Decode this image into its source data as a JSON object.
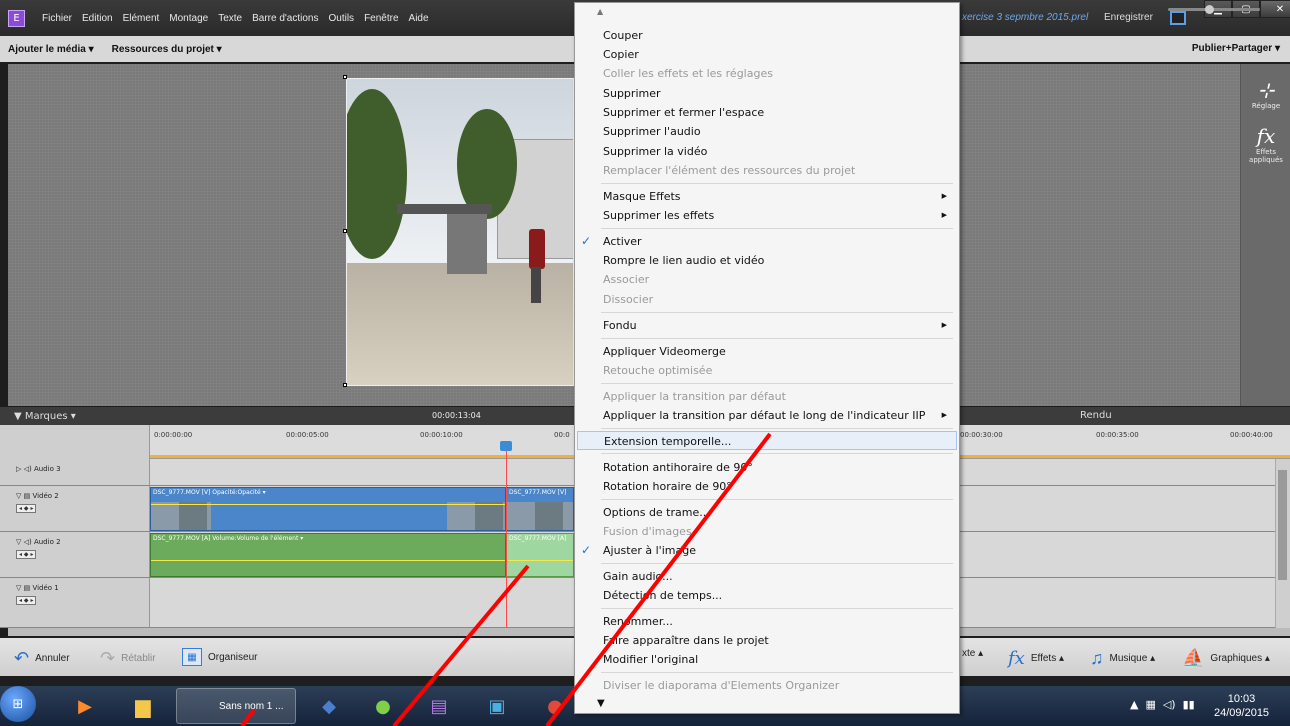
{
  "app": {
    "logo": "E",
    "menu": [
      "Fichier",
      "Edition",
      "Elément",
      "Montage",
      "Texte",
      "Barre d'actions",
      "Outils",
      "Fenêtre",
      "Aide"
    ],
    "project_title": "xercise 3 sepmbre 2015.prel",
    "save_label": "Enregistrer"
  },
  "toolbar": {
    "add_media": "Ajouter le média ▾",
    "project_assets": "Ressources du projet ▾",
    "publish": "Publier+Partager ▾"
  },
  "right_panel": {
    "adjust_label": "Réglage",
    "effects_label": "Effets appliqués",
    "fx_glyph": "fx"
  },
  "timeline": {
    "marques": "▼ Marques  ▾",
    "current_time": "00:00:13:04",
    "render_label": "Rendu",
    "ruler": [
      "0:00:00:00",
      "00:00:05:00",
      "00:00:10:00",
      "00:0",
      "00:00:30:00",
      "00:00:35:00",
      "00:00:40:00"
    ],
    "tracks": {
      "audio3": "Audio 3",
      "video2": "Vidéo 2",
      "audio2": "Audio 2",
      "video1": "Vidéo 1"
    },
    "clips": {
      "v2a": "DSC_9777.MOV [V]  Opacité:Opacité ▾",
      "v2b": "DSC_9777.MOV [V]",
      "a2a": "DSC_9777.MOV [A]  Volume:Volume de l'élément ▾",
      "a2b": "DSC_9777.MOV [A]"
    },
    "ctrl": "◂ ◆ ▸"
  },
  "actions": {
    "undo": "Annuler",
    "redo": "Rétablir",
    "organizer": "Organiseur",
    "text": "xte ▴",
    "effects": "Effets ▴",
    "music": "Musique ▴",
    "graphics": "Graphiques ▴"
  },
  "taskbar": {
    "active_task": "Sans nom 1 ...",
    "time": "10:03",
    "date": "24/09/2015"
  },
  "context_menu": {
    "items": [
      {
        "label": "Couper",
        "enabled": true
      },
      {
        "label": "Copier",
        "enabled": true
      },
      {
        "label": "Coller les effets et les réglages",
        "enabled": false
      },
      {
        "label": "Supprimer",
        "enabled": true
      },
      {
        "label": "Supprimer et fermer l'espace",
        "enabled": true
      },
      {
        "label": "Supprimer l'audio",
        "enabled": true
      },
      {
        "label": "Supprimer la vidéo",
        "enabled": true
      },
      {
        "label": "Remplacer l'élément des ressources du projet",
        "enabled": false
      },
      {
        "label": "Masque Effets",
        "enabled": true,
        "submenu": true
      },
      {
        "label": "Supprimer les effets",
        "enabled": true,
        "submenu": true
      },
      {
        "label": "Activer",
        "enabled": true,
        "checked": true
      },
      {
        "label": "Rompre le lien audio et vidéo",
        "enabled": true
      },
      {
        "label": "Associer",
        "enabled": false
      },
      {
        "label": "Dissocier",
        "enabled": false
      },
      {
        "label": "Fondu",
        "enabled": true,
        "submenu": true
      },
      {
        "label": "Appliquer Videomerge",
        "enabled": true
      },
      {
        "label": "Retouche optimisée",
        "enabled": false
      },
      {
        "label": "Appliquer la transition par défaut",
        "enabled": false
      },
      {
        "label": "Appliquer la transition par défaut le long de l'indicateur IIP",
        "enabled": true,
        "submenu": true
      },
      {
        "label": "Extension temporelle...",
        "enabled": true,
        "highlighted": true
      },
      {
        "label": "Rotation antihoraire de 90°",
        "enabled": true
      },
      {
        "label": "Rotation horaire de 90°",
        "enabled": true
      },
      {
        "label": "Options de trame...",
        "enabled": true
      },
      {
        "label": "Fusion d'images",
        "enabled": false
      },
      {
        "label": "Ajuster à l'image",
        "enabled": true,
        "checked": true
      },
      {
        "label": "Gain audio...",
        "enabled": true
      },
      {
        "label": "Détection de temps...",
        "enabled": true
      },
      {
        "label": "Renommer...",
        "enabled": true
      },
      {
        "label": "Faire apparaître dans le projet",
        "enabled": true
      },
      {
        "label": "Modifier l'original",
        "enabled": true
      },
      {
        "label": "Diviser le diaporama d'Elements Organizer",
        "enabled": false
      }
    ],
    "scroll_up": "▲",
    "scroll_down": "▼"
  },
  "colors": {
    "accent": "#2a6fc9",
    "annotation": "#ff0000",
    "playhead": "#ff4a4a"
  }
}
